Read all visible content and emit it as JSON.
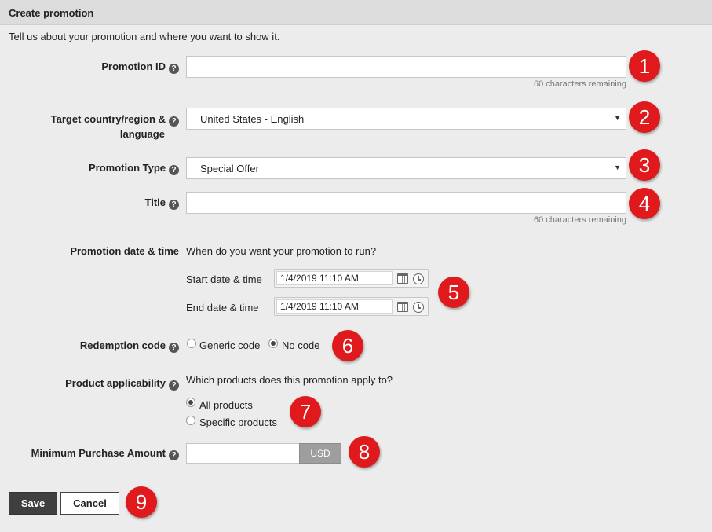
{
  "header": {
    "title": "Create promotion"
  },
  "intro": "Tell us about your promotion and where you want to show it.",
  "fields": {
    "promotion_id": {
      "label": "Promotion ID",
      "value": "",
      "remaining": "60 characters remaining"
    },
    "target": {
      "label_line1": "Target country/region &",
      "label_line2": "language",
      "value": "United States - English"
    },
    "promotion_type": {
      "label": "Promotion Type",
      "value": "Special Offer"
    },
    "title": {
      "label": "Title",
      "value": "",
      "remaining": "60 characters remaining"
    },
    "date_time": {
      "label": "Promotion date & time",
      "question": "When do you want your promotion to run?",
      "start_label": "Start date & time",
      "start_value": "1/4/2019 11:10 AM",
      "end_label": "End date & time",
      "end_value": "1/4/2019 11:10 AM"
    },
    "redemption": {
      "label": "Redemption code",
      "options": [
        "Generic code",
        "No code"
      ],
      "selected": "No code"
    },
    "applicability": {
      "label": "Product applicability",
      "question": "Which products does this promotion apply to?",
      "options": [
        "All products",
        "Specific products"
      ],
      "selected": "All products"
    },
    "minimum": {
      "label": "Minimum Purchase Amount",
      "value": "",
      "currency": "USD"
    }
  },
  "buttons": {
    "save": "Save",
    "cancel": "Cancel"
  },
  "badges": [
    "1",
    "2",
    "3",
    "4",
    "5",
    "6",
    "7",
    "8",
    "9"
  ],
  "colors": {
    "badge": "#e0191c",
    "save_button": "#3f3f3f",
    "header_bg": "#dcdcdc",
    "page_bg": "#ececec"
  },
  "icons": [
    "help-icon",
    "dropdown-arrow-icon",
    "calendar-icon",
    "clock-icon"
  ]
}
